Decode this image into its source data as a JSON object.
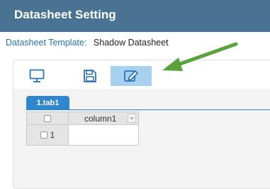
{
  "header": {
    "title": "Datasheet Setting"
  },
  "template": {
    "label": "Datasheet Template:",
    "value": "Shadow Datasheet"
  },
  "toolbar": {
    "tools": [
      {
        "icon": "monitor-icon"
      },
      {
        "icon": "save-icon"
      },
      {
        "icon": "edit-icon",
        "active": true
      }
    ]
  },
  "tabs": [
    {
      "label": "1.tab1",
      "active": true
    }
  ],
  "grid": {
    "columns": [
      "column1"
    ],
    "rows": [
      {
        "number": "1",
        "value": ""
      }
    ]
  },
  "colors": {
    "header_bg": "#4a7393",
    "tab_bg": "#2f87cf",
    "active_tool_bg": "#a8d1f0",
    "annotation_arrow": "#5aa23d",
    "icon_color": "#2a73b6"
  }
}
